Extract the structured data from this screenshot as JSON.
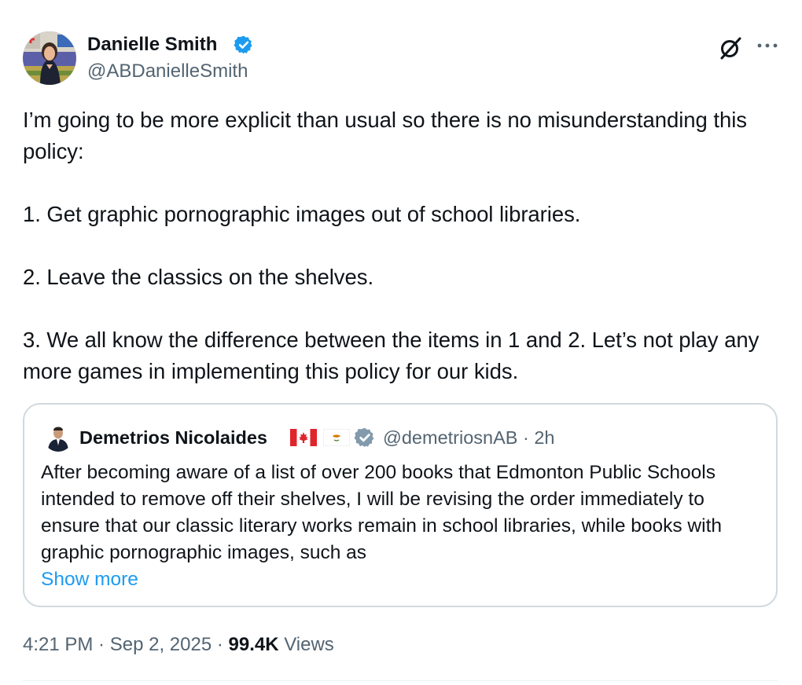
{
  "author": {
    "name": "Danielle Smith",
    "handle": "@ABDanielleSmith",
    "verified_color": "#1d9bf0"
  },
  "header_icons": [
    "grok-icon",
    "more-icon"
  ],
  "tweet": {
    "paragraphs": [
      "I’m going to be more explicit than usual so there is no misunderstanding this policy:",
      "1. Get graphic pornographic images out of school libraries.",
      "2. Leave the classics on the shelves.",
      "3. We all know the difference between the items in 1 and 2. Let’s not play any more games in implementing this policy for our kids."
    ]
  },
  "quote": {
    "name": "Demetrios Nicolaides",
    "flags": [
      "canada-flag-icon",
      "cyprus-flag-icon"
    ],
    "verified_color": "#829aab",
    "handle_time": "@demetriosnAB · 2h",
    "text": "After becoming aware of a list of over 200 books that Edmonton Public Schools intended to remove off their shelves, I will be revising the order immediately to ensure that our classic literary works remain in school libraries, while books with graphic pornographic images, such as",
    "show_more": "Show more"
  },
  "meta": {
    "time": "4:21 PM",
    "date": "Sep 2, 2025",
    "views_count": "99.4K",
    "views_label": "Views"
  },
  "colors": {
    "accent": "#1d9bf0",
    "text": "#0f1419",
    "secondary": "#536471",
    "border": "#cfd9de"
  }
}
